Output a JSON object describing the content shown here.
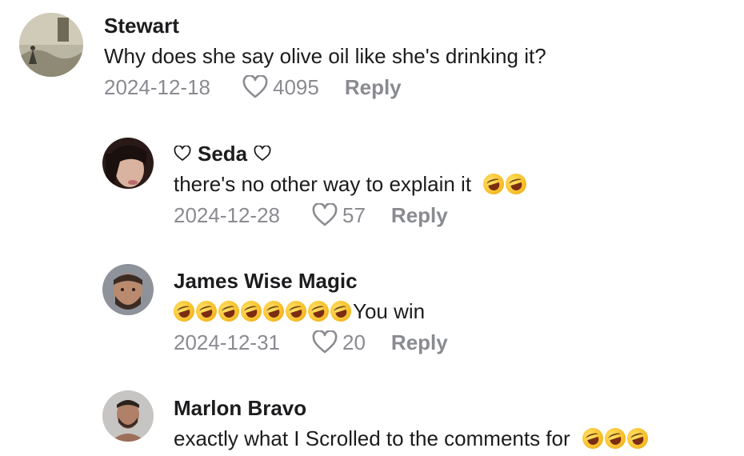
{
  "comments": [
    {
      "username": "Stewart",
      "text": "Why does she say olive oil like she's drinking it?",
      "date": "2024-12-18",
      "likes": "4095",
      "reply_label": "Reply"
    },
    {
      "username": "Seda",
      "text": "there's no other way to explain it",
      "emoji_count": 2,
      "date": "2024-12-28",
      "likes": "57",
      "reply_label": "Reply"
    },
    {
      "username": "James Wise Magic",
      "text": "You win",
      "emoji_count": 8,
      "date": "2024-12-31",
      "likes": "20",
      "reply_label": "Reply"
    },
    {
      "username": "Marlon Bravo",
      "text": "exactly what I Scrolled to the comments for",
      "emoji_count": 3
    }
  ],
  "icons": {
    "like": "heart-outline-icon",
    "emoji": "rolling-on-floor-laughing-emoji"
  },
  "colors": {
    "text": "#1c1c1e",
    "meta": "#8a8b91"
  }
}
